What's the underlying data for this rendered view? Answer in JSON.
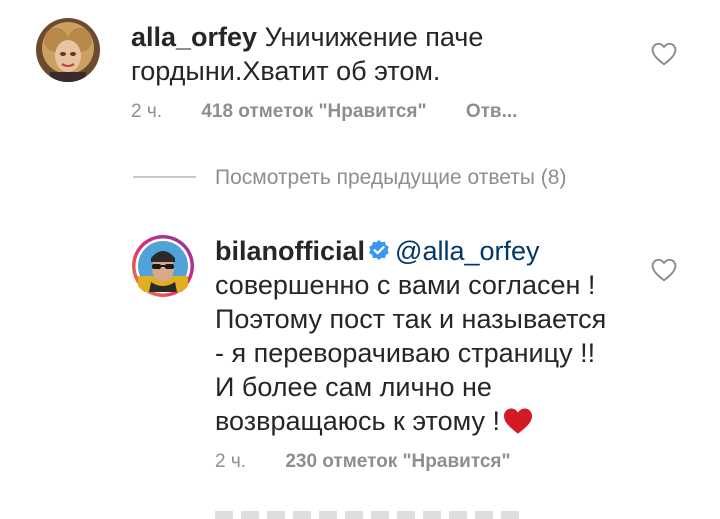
{
  "comments": [
    {
      "username": "alla_orfey",
      "text": "Уничижение паче гордыни.Хватит об этом.",
      "time": "2 ч.",
      "likes": "418 отметок \"Нравится\"",
      "reply": "Отв..."
    }
  ],
  "replies_toggle": {
    "label": "Посмотреть предыдущие ответы (8)"
  },
  "replies": [
    {
      "username": "bilanofficial",
      "verified": true,
      "mention": "@alla_orfey",
      "text": "совершенно с вами согласен ! Поэтому пост так и называется - я переворачиваю страницу !! И более сам лично не возвращаюсь к этому !",
      "time": "2 ч.",
      "likes": "230 отметок \"Нравится\""
    }
  ],
  "icons": {
    "like": "heart-outline-icon",
    "verified": "verified-badge-icon",
    "emoji": "red-heart-icon"
  },
  "colors": {
    "text": "#262626",
    "secondary": "#8e8e8e",
    "verified": "#3897f0",
    "mention": "#00376b",
    "heart": "#ed4956"
  }
}
